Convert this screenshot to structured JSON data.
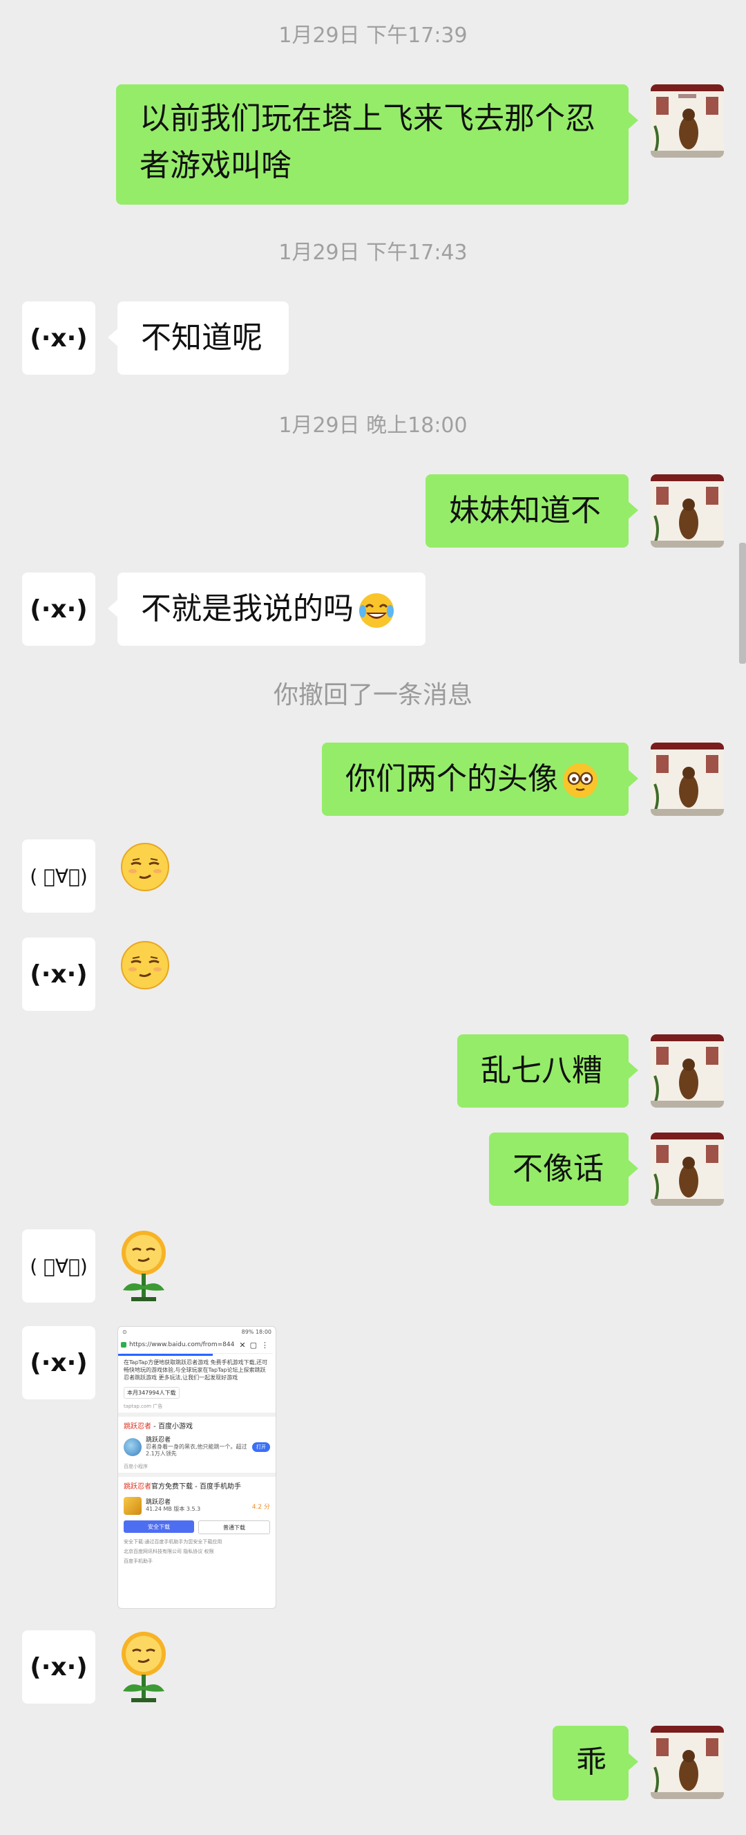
{
  "conversation": {
    "timestamps": [
      "1月29日 下午17:39",
      "1月29日 下午17:43",
      "1月29日 晚上18:00"
    ],
    "recall_notice": "你撤回了一条消息",
    "contacts": {
      "contact_a_avatar": "(·x·)",
      "contact_b_avatar": "( ﾟ∀ﾟ)"
    },
    "messages": {
      "m1": "以前我们玩在塔上飞来飞去那个忍者游戏叫啥",
      "m2": "不知道呢",
      "m3": "妹妹知道不",
      "m4": "不就是我说的吗",
      "m5": "你们两个的头像",
      "m6": "乱七八糟",
      "m7": "不像话",
      "m8": "乖"
    },
    "icons": {
      "m4_emoji": "tears-of-joy-emoji",
      "m5_emoji": "glasses-nerd-emoji",
      "sticker_smug": "smug-face-sticker",
      "sticker_flower": "smug-flower-sticker"
    }
  },
  "shared_screenshot": {
    "status_time": "18:00",
    "status_battery": "89%",
    "url": "https://www.baidu.com/from=844",
    "intro_text": "在TapTap方便地获取跳跃忍者游戏 免费手机游戏下载,还可畅快地玩的游戏体验,与全球玩家在TapTap论坛上探索跳跃忍者跳跃游戏 更多玩法,让我们一起发现好游戏",
    "download_count": "本月347994人下载",
    "source_meta": "taptap.com  广告",
    "result1_title_red": "跳跃忍者",
    "result1_title_rest": " - 百度小游戏",
    "result1_app_name": "跳跃忍者",
    "result1_app_desc": "忍者身着一身的黑衣,他只能跳一个。超过2.1万人领先",
    "result1_button": "打开",
    "result1_meta": "百度小程序",
    "result2_title_red": "跳跃忍者",
    "result2_title_rest": "官方免费下载 - 百度手机助手",
    "result2_app_name": "跳跃忍者",
    "result2_app_info": "41.24 MB  版本 3.5.3",
    "result2_rating": "4.2 分",
    "result2_btn_primary": "安全下载",
    "result2_btn_secondary": "普通下载",
    "result2_note": "安全下载:通过百度手机助手为您安全下载应用",
    "result2_company": "北京百度网讯科技有限公司",
    "result2_links": "隐私协议  权限",
    "result2_footer": "百度手机助手"
  }
}
